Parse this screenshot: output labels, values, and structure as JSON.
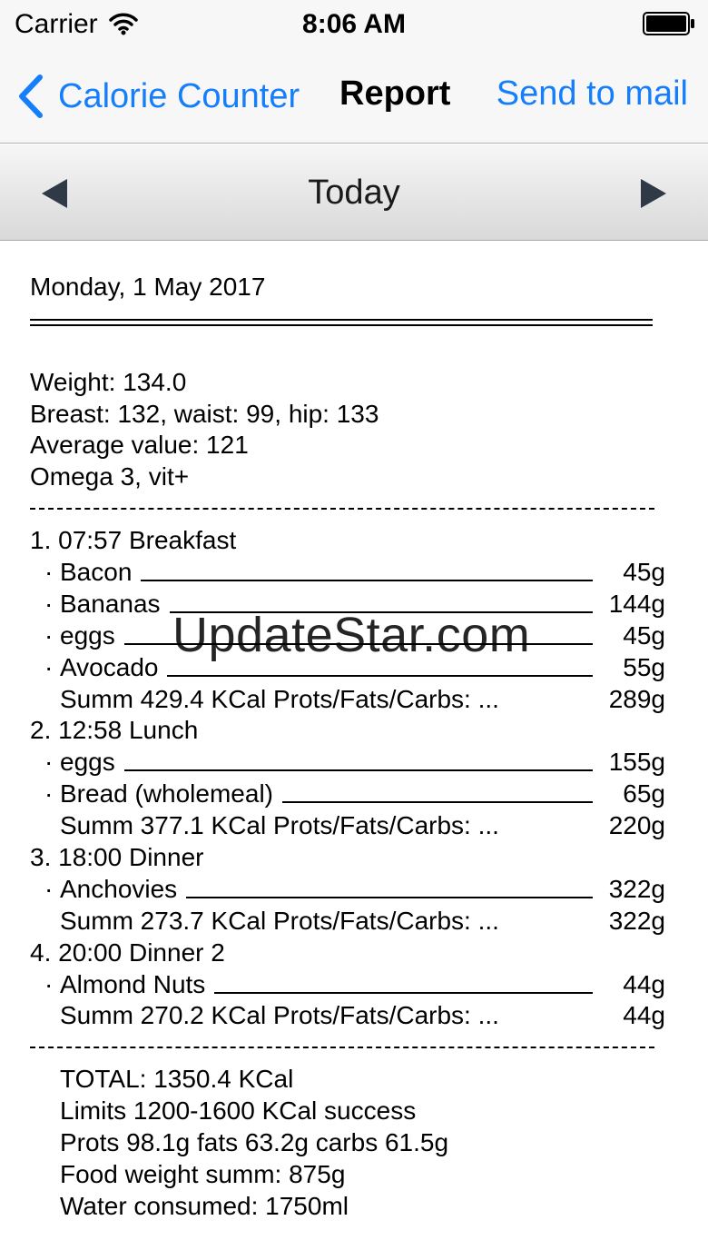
{
  "status_bar": {
    "carrier": "Carrier",
    "time": "8:06 AM"
  },
  "nav": {
    "back_label": "Calorie Counter",
    "title": "Report",
    "action_label": "Send to mail"
  },
  "date_selector": {
    "label": "Today"
  },
  "report": {
    "date": "Monday, 1 May 2017",
    "measurements": [
      "Weight: 134.0",
      "Breast: 132, waist: 99, hip: 133",
      "Average value: 121",
      "Omega 3, vit+"
    ],
    "meals": [
      {
        "title": "1. 07:57 Breakfast",
        "items": [
          {
            "name": "Bacon",
            "weight": "45g"
          },
          {
            "name": "Bananas",
            "weight": "144g"
          },
          {
            "name": "eggs",
            "weight": "45g"
          },
          {
            "name": "Avocado",
            "weight": "55g"
          }
        ],
        "summ": "Summ 429.4 KCal Prots/Fats/Carbs: ...",
        "summ_weight": "289g"
      },
      {
        "title": "2. 12:58 Lunch",
        "items": [
          {
            "name": "eggs",
            "weight": "155g"
          },
          {
            "name": "Bread (wholemeal)",
            "weight": "65g"
          }
        ],
        "summ": "Summ 377.1 KCal Prots/Fats/Carbs: ...",
        "summ_weight": "220g"
      },
      {
        "title": "3. 18:00 Dinner",
        "items": [
          {
            "name": "Anchovies",
            "weight": "322g"
          }
        ],
        "summ": "Summ 273.7 KCal Prots/Fats/Carbs: ...",
        "summ_weight": "322g"
      },
      {
        "title": "4. 20:00 Dinner 2",
        "items": [
          {
            "name": "Almond Nuts",
            "weight": "44g"
          }
        ],
        "summ": "Summ 270.2 KCal Prots/Fats/Carbs: ...",
        "summ_weight": "44g"
      }
    ],
    "totals": [
      "TOTAL: 1350.4 KCal",
      "Limits 1200-1600 KCal success",
      "Prots 98.1g fats 63.2g carbs 61.5g",
      "Food weight summ: 875g",
      "Water consumed: 1750ml"
    ]
  },
  "watermark": "UpdateStar.com",
  "colors": {
    "accent": "#157efb"
  }
}
